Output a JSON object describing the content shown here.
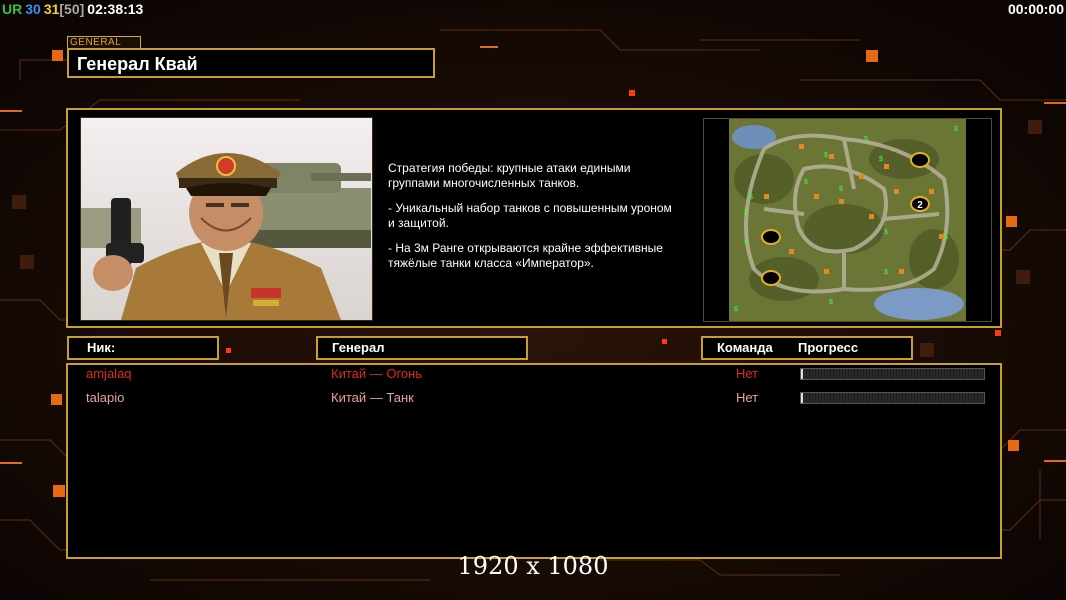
{
  "hud": {
    "ur_label": "UR",
    "val_a": "30",
    "val_b": "31",
    "val_c": "[50]",
    "clock": "02:38:13",
    "timer": "00:00:00"
  },
  "header": {
    "tag": "GENERAL",
    "title": "Генерал Квай"
  },
  "description": [
    "Стратегия победы: крупные атаки едиными\n группами многочисленных танков.",
    "- Уникальный набор танков с повышенным уроном\n и защитой.",
    "- На 3м Ранге открываются крайне эффективные\n тяжёлые танки класса «Император»."
  ],
  "minimap": {
    "start_label": "2"
  },
  "columns": {
    "nick": "Ник:",
    "general": "Генерал",
    "team": "Команда",
    "progress": "Прогресс"
  },
  "players": [
    {
      "nick": "amjalaq",
      "general": "Китай — Огонь",
      "team": "Нет",
      "progress": 0.01,
      "color": "#e02a1a"
    },
    {
      "nick": "talapio",
      "general": "Китай — Танк",
      "team": "Нет",
      "progress": 0.01,
      "color": "#e8a0a0"
    }
  ],
  "footer": {
    "resolution": "1920 x 1080"
  },
  "colors": {
    "frame": "#c79f2a",
    "hud_ur": "#36c23a",
    "hud_a": "#3a8ff0",
    "hud_b": "#f2d320",
    "hud_c": "#a8a8a8"
  }
}
